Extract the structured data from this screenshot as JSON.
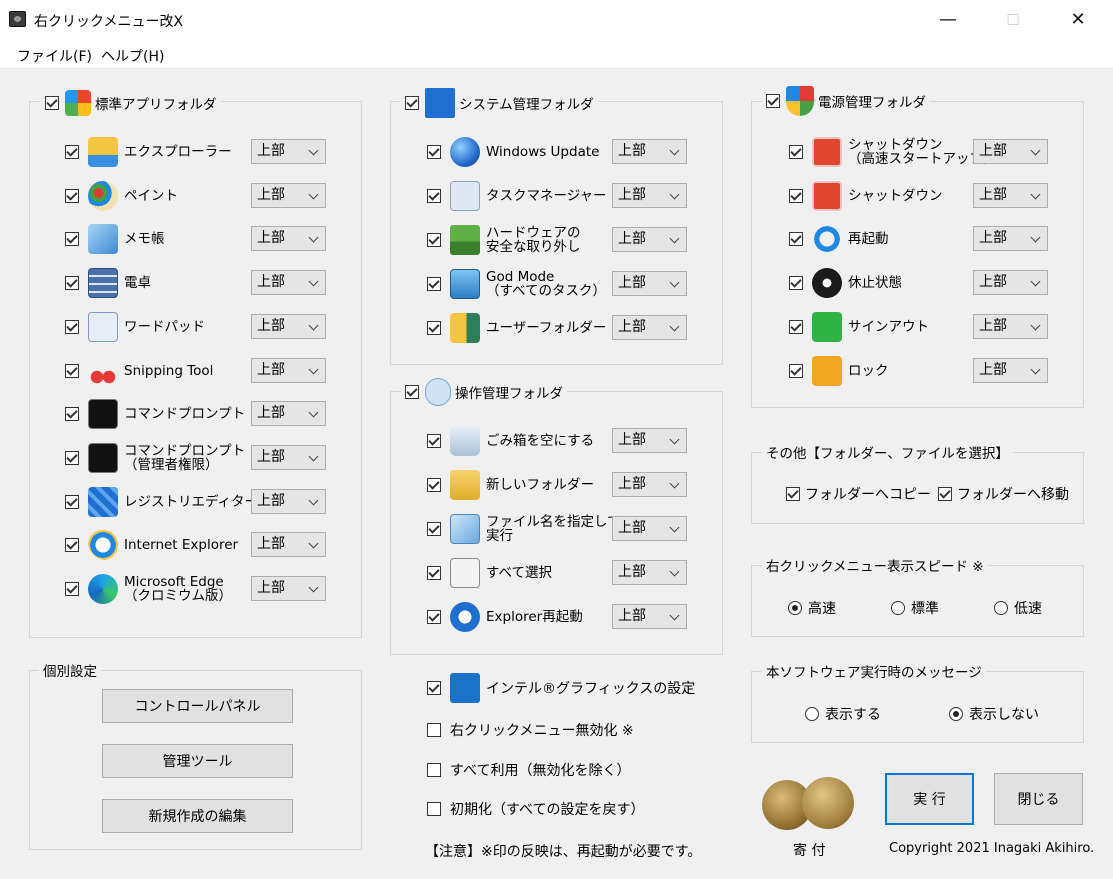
{
  "window": {
    "title": "右クリックメニュー改X",
    "minimize": "—",
    "maximize": "☐",
    "close": "✕"
  },
  "menu": {
    "file": "ファイル(F)",
    "help": "ヘルプ(H)"
  },
  "position_default": "上部",
  "standard": {
    "title": "標準アプリフォルダ",
    "items": [
      {
        "label": "エクスプローラー",
        "icon": "explorer-folder-icon",
        "value": "上部"
      },
      {
        "label": "ペイント",
        "icon": "paint-icon",
        "value": "上部"
      },
      {
        "label": "メモ帳",
        "icon": "notepad-icon",
        "value": "上部"
      },
      {
        "label": "電卓",
        "icon": "calculator-icon",
        "value": "上部"
      },
      {
        "label": "ワードパッド",
        "icon": "wordpad-icon",
        "value": "上部"
      },
      {
        "label": "Snipping Tool",
        "icon": "scissors-icon",
        "value": "上部"
      },
      {
        "label": "コマンドプロンプト",
        "icon": "cmd-icon",
        "value": "上部"
      },
      {
        "label": "コマンドプロンプト\n（管理者権限）",
        "icon": "cmd-admin-icon",
        "value": "上部"
      },
      {
        "label": "レジストリエディター",
        "icon": "registry-icon",
        "value": "上部"
      },
      {
        "label": "Internet Explorer",
        "icon": "ie-icon",
        "value": "上部"
      },
      {
        "label": "Microsoft Edge\n（クロミウム版）",
        "icon": "edge-icon",
        "value": "上部"
      }
    ]
  },
  "system": {
    "title": "システム管理フォルダ",
    "items": [
      {
        "label": "Windows Update",
        "icon": "globe-icon",
        "value": "上部"
      },
      {
        "label": "タスクマネージャー",
        "icon": "task-manager-icon",
        "value": "上部"
      },
      {
        "label": "ハードウェアの\n安全な取り外し",
        "icon": "usb-eject-icon",
        "value": "上部"
      },
      {
        "label": "God Mode\n（すべてのタスク）",
        "icon": "control-panel-icon",
        "value": "上部"
      },
      {
        "label": "ユーザーフォルダー",
        "icon": "user-folder-icon",
        "value": "上部"
      }
    ]
  },
  "operation": {
    "title": "操作管理フォルダ",
    "items": [
      {
        "label": "ごみ箱を空にする",
        "icon": "recycle-bin-icon",
        "value": "上部"
      },
      {
        "label": "新しいフォルダー",
        "icon": "new-folder-icon",
        "value": "上部"
      },
      {
        "label": "ファイル名を指定して\n実行",
        "icon": "run-icon",
        "value": "上部"
      },
      {
        "label": "すべて選択",
        "icon": "select-all-icon",
        "value": "上部"
      },
      {
        "label": "Explorer再起動",
        "icon": "restart-explorer-icon",
        "value": "上部"
      }
    ]
  },
  "power": {
    "title": "電源管理フォルダ",
    "items": [
      {
        "label": "シャットダウン\n（高速スタートアップ）",
        "icon": "power-icon",
        "value": "上部"
      },
      {
        "label": "シャットダウン",
        "icon": "power-icon",
        "value": "上部"
      },
      {
        "label": "再起動",
        "icon": "refresh-icon",
        "value": "上部"
      },
      {
        "label": "休止状態",
        "icon": "clock-icon",
        "value": "上部"
      },
      {
        "label": "サインアウト",
        "icon": "sign-out-icon",
        "value": "上部"
      },
      {
        "label": "ロック",
        "icon": "key-icon",
        "value": "上部"
      }
    ]
  },
  "other": {
    "title": "その他【フォルダー、ファイルを選択】",
    "copy": "フォルダーへコピー",
    "move": "フォルダーへ移動"
  },
  "speed": {
    "title": "右クリックメニュー表示スピード ※",
    "options": [
      "高速",
      "標準",
      "低速"
    ],
    "selected": "高速"
  },
  "message": {
    "title": "本ソフトウェア実行時のメッセージ",
    "options": [
      "表示する",
      "表示しない"
    ],
    "selected": "表示しない"
  },
  "individual": {
    "title": "個別設定",
    "buttons": [
      "コントロールパネル",
      "管理ツール",
      "新規作成の編集"
    ]
  },
  "bottom": {
    "intel": "インテル®グラフィックスの設定",
    "disable": "右クリックメニュー無効化 ※",
    "useall": "すべて利用（無効化を除く）",
    "init": "初期化（すべての設定を戻す）",
    "note": "【注意】※印の反映は、再起動が必要です。"
  },
  "actions": {
    "donate": "寄 付",
    "run": "実 行",
    "close": "閉じる",
    "copyright": "Copyright 2021 Inagaki Akihiro."
  },
  "colors": {
    "accent": "#0078d7",
    "panel": "#f0f0f0"
  }
}
